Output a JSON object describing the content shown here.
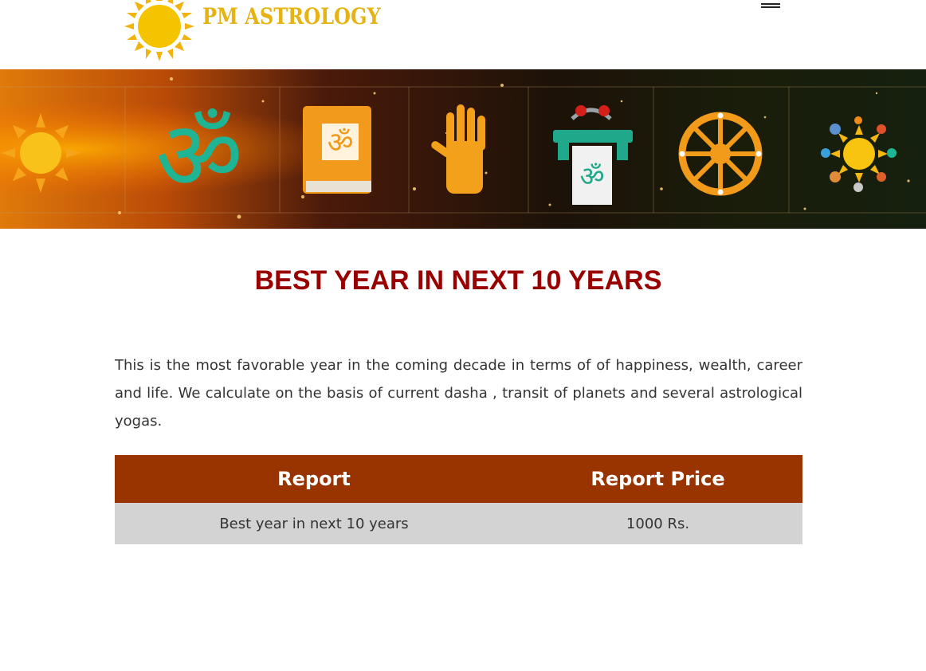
{
  "header": {
    "logo_text": "PM ASTROLOGY",
    "menu_icon": "hamburger-menu-icon"
  },
  "banner": {
    "icons": [
      "sun-icon",
      "om-icon",
      "scripture-book-icon",
      "palm-icon",
      "om-stand-icon",
      "dharma-wheel-icon",
      "solar-system-icon"
    ]
  },
  "main": {
    "title": "BEST YEAR IN NEXT 10 YEARS",
    "description": "This is the most favorable year in the coming decade in terms of of happiness, wealth, career and life. We calculate on the basis of current dasha , transit of planets and several astrological yogas."
  },
  "table": {
    "headers": [
      "Report",
      "Report Price"
    ],
    "rows": [
      [
        "Best year in next 10 years",
        "1000 Rs."
      ]
    ]
  },
  "colors": {
    "title": "#990000",
    "table_header_bg": "#993300",
    "table_row_bg": "#d3d3d3",
    "logo": "#e5b414"
  }
}
